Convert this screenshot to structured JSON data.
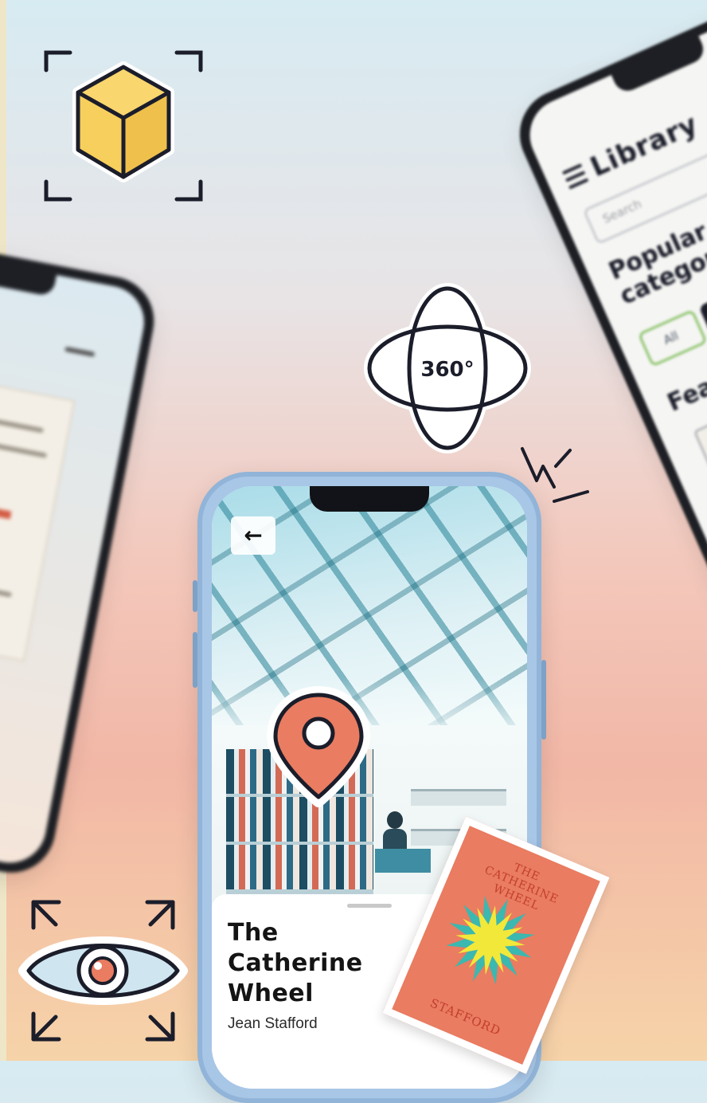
{
  "left_phone": {},
  "right_phone": {
    "title": "Library",
    "search_placeholder": "Search",
    "section_popular": "Popular\ncategories",
    "chip_all": "All",
    "section_featured": "Featured"
  },
  "main_phone": {
    "back_icon": "arrow-left-icon",
    "book_title": "The\nCatherine\nWheel",
    "book_author": "Jean Stafford"
  },
  "stickers": {
    "ar_cube": "ar-cube-icon",
    "orbit_label": "360°",
    "location": "location-pin-icon",
    "view": "eye-icon"
  },
  "book_cover": {
    "title": "THE\nCATHERINE\nWHEEL",
    "author": "STAFFORD"
  },
  "colors": {
    "accent_coral": "#e97c61",
    "outline": "#1b1d2a",
    "cube_yellow": "#f7cf5c",
    "chip_green": "#8cc36b"
  }
}
